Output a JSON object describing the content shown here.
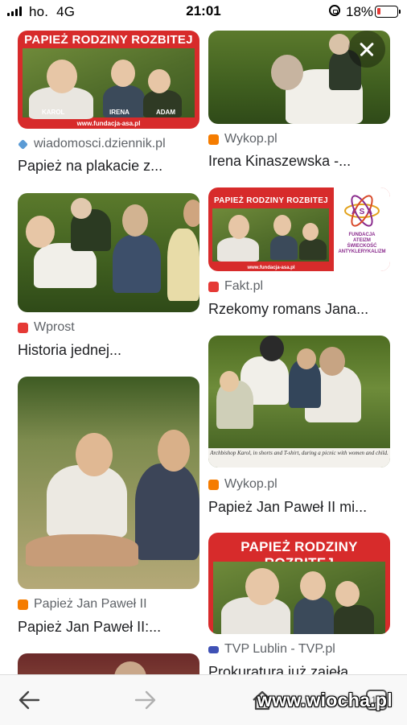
{
  "status": {
    "carrier": "ho.",
    "network": "4G",
    "time": "21:01",
    "battery_pct": "18%",
    "battery_level": 0.18,
    "battery_color": "#e53935"
  },
  "results": [
    {
      "source": "wiadomosci.dziennik.pl",
      "title": "Papież na plakacie z...",
      "image_text": {
        "header": "PAPIEŻ RODZINY ROZBITEJ",
        "names": [
          "KAROL",
          "IRENA",
          "ADAM"
        ],
        "url": "www.fundacja-asa.pl"
      }
    },
    {
      "source": "Wykop.pl",
      "title": "Irena Kinaszewska -..."
    },
    {
      "source": "Wprost",
      "title": "Historia jednej..."
    },
    {
      "source": "Fakt.pl",
      "title": "Rzekomy romans Jana...",
      "image_text": {
        "header": "PAPIEŻ RODZINY ROZBITEJ",
        "names": [
          "KAROL",
          "IRENA",
          "ADAM"
        ],
        "url": "www.fundacja-asa.pl",
        "logo_letters": "A S A",
        "logo_lines": [
          "FUNDACJA",
          "ATEIZM",
          "ŚWIECKOŚĆ",
          "ANTYKLERYKALIZM"
        ]
      }
    },
    {
      "source": "Papież Jan Paweł II",
      "title": "Papież Jan Paweł II:..."
    },
    {
      "source": "Wykop.pl",
      "title": "Papież Jan Paweł II mi...",
      "image_text": {
        "caption": "Archbishop Karol, in shorts and T-shirt, during a picnic with women and child."
      }
    },
    {
      "source": "TVP Lublin - TVP.pl",
      "title": "Prokuratura już zajęła...",
      "image_text": {
        "header": "PAPIEŻ RODZINY ROZBITEJ"
      }
    }
  ],
  "close_icon": "close-icon",
  "toolbar": {
    "back_icon": "back-arrow-icon",
    "forward_icon": "forward-arrow-icon",
    "home_icon": "home-icon",
    "tabs_count": "10"
  },
  "watermark": "www.wiocha.pl",
  "colors": {
    "poster_red": "#d72b2b",
    "wykop": "#f57c00",
    "wprost": "#e53935",
    "fakt": "#e53935",
    "blogger": "#f57c00",
    "tvp": "#3f51b5"
  }
}
